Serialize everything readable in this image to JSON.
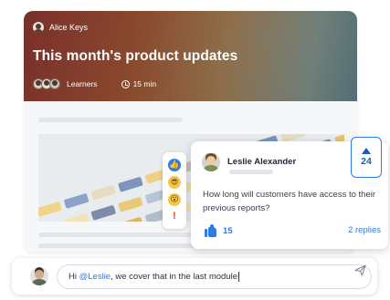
{
  "course": {
    "author": "Alice Keys",
    "title": "This month's product updates",
    "learners_label": "Learners",
    "duration": "15 min"
  },
  "comment": {
    "author": "Leslie Alexander",
    "text": "How long will customers have access to their previous reports?",
    "like_count": "15",
    "replies": "2 replies",
    "vote_count": "24"
  },
  "reactions": [
    "thumbs-up-icon",
    "nerd-face-icon",
    "hushed-face-icon",
    "exclamation-icon"
  ],
  "reply": {
    "prefix": "Hi ",
    "mention": "@Leslie",
    "suffix": ", we cover that in the last module"
  },
  "colors": {
    "accent": "#2f7be5",
    "banner_start": "#7a2f2a",
    "banner_end": "#4e6b72"
  }
}
